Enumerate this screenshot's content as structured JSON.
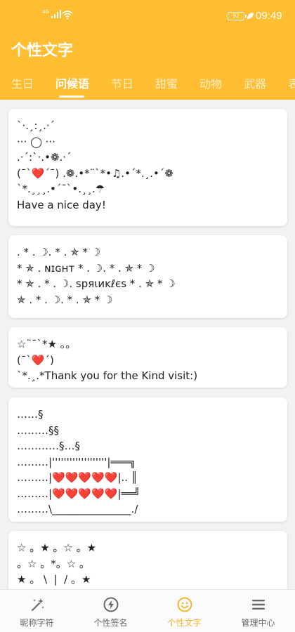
{
  "status": {
    "signal_tag": "4G",
    "battery": "92",
    "time": "09:49"
  },
  "app": {
    "title": "个性文字"
  },
  "tabs": [
    {
      "label": "生日"
    },
    {
      "label": "问候语"
    },
    {
      "label": "节日"
    },
    {
      "label": "甜蜜"
    },
    {
      "label": "动物"
    },
    {
      "label": "武器"
    },
    {
      "label": "表"
    }
  ],
  "active_tab": "问候语",
  "cards": [
    {
      "text": "`·.¸:¸.·´\n··· ◯ ···\n.·´:`·.•❁.·´\n(¯`❤️´¯) .❁.•*¨`*•♫.•´*.¸.•´❁\n`*.¸¸¸.•´¯`•.¸¸.☂\nHave a nice day!"
    },
    {
      "text": ". * . ☽. * . ✯ * ☽\n* ✯ . ɴɪɢнт * . ☽. * . ✯ * ☽\n* ✯ . * . ☽. ѕpяιиĸℓєѕ * . ✯ * ☽\n✯ . * . ☽. * . ✯ * ☽"
    },
    {
      "text": "☆¨¯`*★ 。。\n(¯`❤️´)\n`*.¸.*Thank you for the Kind visit:)"
    },
    {
      "text": "……§\n………§§\n…………§…§\n………|'''''''''''''''''''|═══╗\n………|❤️❤️❤️❤️❤️|.. ║\n………|❤️❤️❤️❤️❤️|══╝\n………\\_______________./"
    },
    {
      "text": "☆ 。★ 。☆ 。★\n。☆ 。*。☆ 。\n★ 。 \\  |  / 。★"
    }
  ],
  "bottom_nav": [
    {
      "label": "昵称字符",
      "icon": "magic-wand-icon"
    },
    {
      "label": "个性签名",
      "icon": "lightning-icon"
    },
    {
      "label": "个性文字",
      "icon": "smiley-icon"
    },
    {
      "label": "管理中心",
      "icon": "menu-icon"
    }
  ],
  "colors": {
    "primary": "#FFBE32",
    "active_nav": "#F5B52B",
    "background": "#F2F2F2"
  }
}
